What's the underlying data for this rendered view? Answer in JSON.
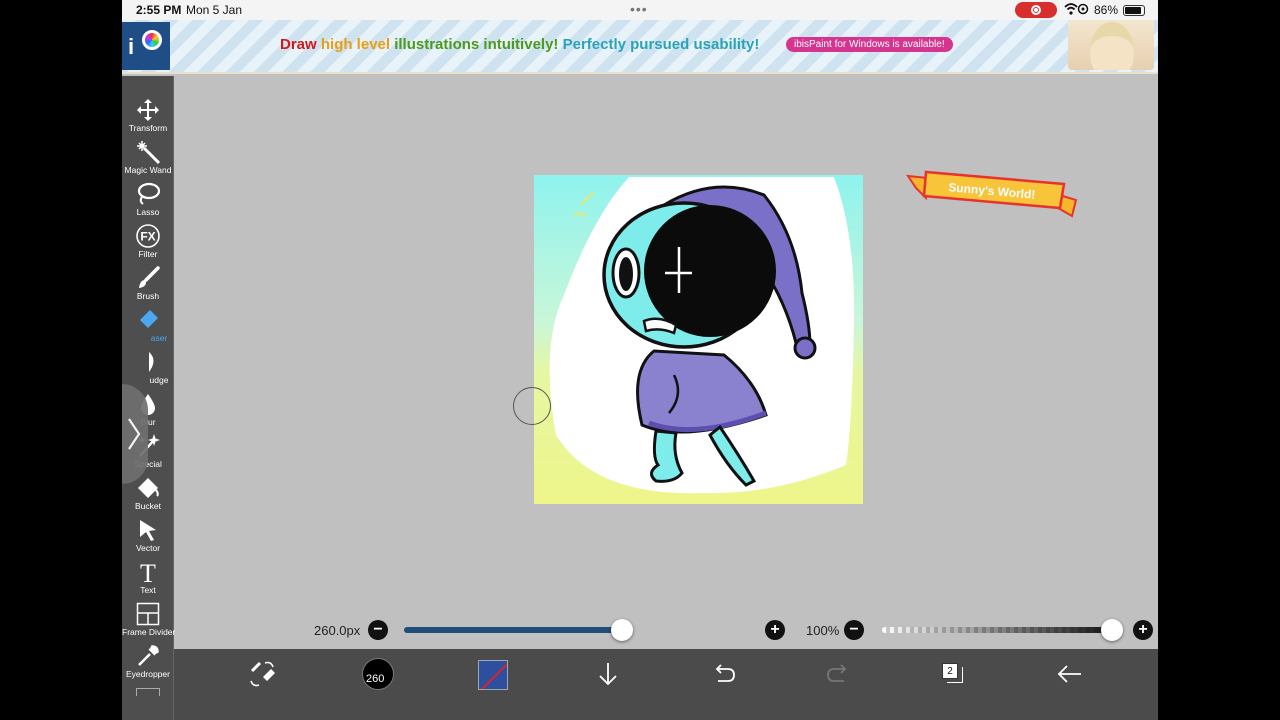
{
  "status_bar": {
    "time": "2:55 PM",
    "date": "Mon 5 Jan",
    "battery": "86%",
    "battery_fraction": 0.86
  },
  "ad": {
    "logo_text": "i",
    "headline_1": "Draw ",
    "headline_2": "high level ",
    "headline_3": "illustrations ",
    "headline_4": "intuitively! ",
    "headline_5": "Perfectly pursued usability!",
    "pill": "ibisPaint for Windows is available!"
  },
  "tools": [
    {
      "label": "Transform",
      "icon": "move-arrows-icon"
    },
    {
      "label": "Magic Wand",
      "icon": "magic-wand-icon"
    },
    {
      "label": "Lasso",
      "icon": "lasso-icon"
    },
    {
      "label": "Filter",
      "icon": "fx-icon"
    },
    {
      "label": "Brush",
      "icon": "brush-icon"
    },
    {
      "label": "Eraser",
      "icon": "eraser-icon",
      "visible_label": "aser"
    },
    {
      "label": "Smudge",
      "icon": "smudge-icon",
      "visible_label": "udge"
    },
    {
      "label": "Blur",
      "icon": "blur-drop-icon"
    },
    {
      "label": "Special",
      "icon": "special-sparkle-icon"
    },
    {
      "label": "Bucket",
      "icon": "bucket-icon"
    },
    {
      "label": "Vector",
      "icon": "vector-arrow-icon"
    },
    {
      "label": "Text",
      "icon": "text-t-icon"
    },
    {
      "label": "Frame Divider",
      "icon": "frame-divider-icon"
    },
    {
      "label": "Eyedropper",
      "icon": "eyedropper-icon"
    }
  ],
  "active_tool": "Eraser",
  "canvas": {
    "sticker_text": "Sunny's World!"
  },
  "brush_size": {
    "label": "260.0px",
    "value": 260,
    "fraction": 0.97
  },
  "opacity": {
    "label": "100%",
    "fraction": 1.0
  },
  "bottom_bar": {
    "brush_size_badge": "260",
    "layer_count": "2",
    "primary_color": "#2e4ea0"
  },
  "colors": {
    "accent_blue": "#4aa8f0",
    "slider_fill": "#1f4e79"
  }
}
